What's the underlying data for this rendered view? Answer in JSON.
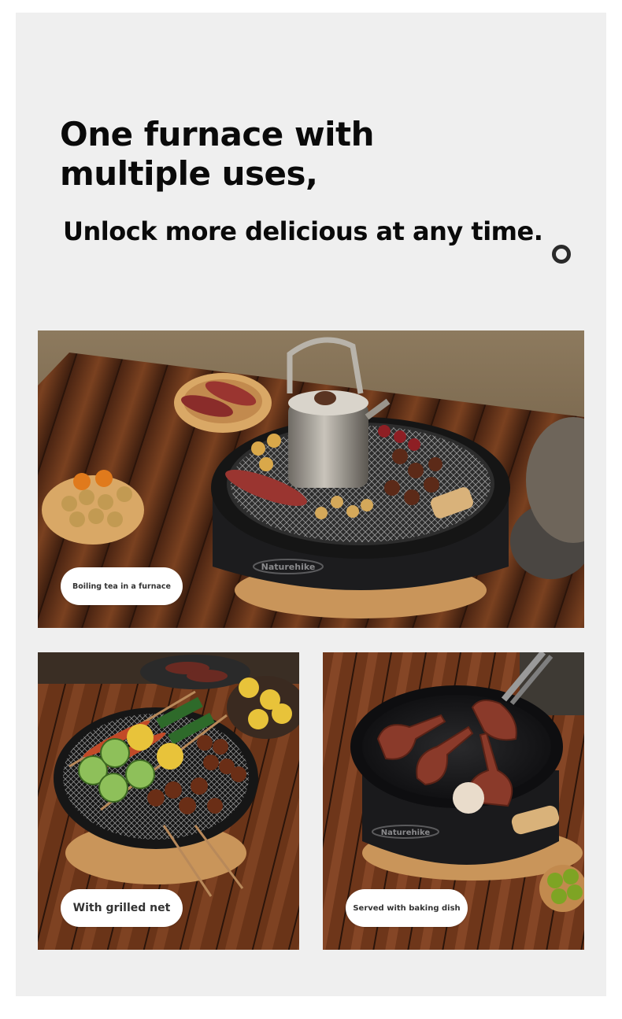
{
  "hero": {
    "headline_line1": "One furnace with",
    "headline_line2": "multiple uses,",
    "subheadline": "Unlock more delicious at any time."
  },
  "photos": [
    {
      "caption": "Boiling tea in a furnace",
      "brand_mark": "Naturehike"
    },
    {
      "caption": "With grilled net"
    },
    {
      "caption": "Served with baking dish",
      "brand_mark": "Naturehike"
    }
  ],
  "colors": {
    "panel_bg": "#efefef",
    "text": "#0a0a0a",
    "caption_bg": "#ffffff",
    "wood": "#6b3a1e",
    "grill_body": "#1c1c1e"
  }
}
